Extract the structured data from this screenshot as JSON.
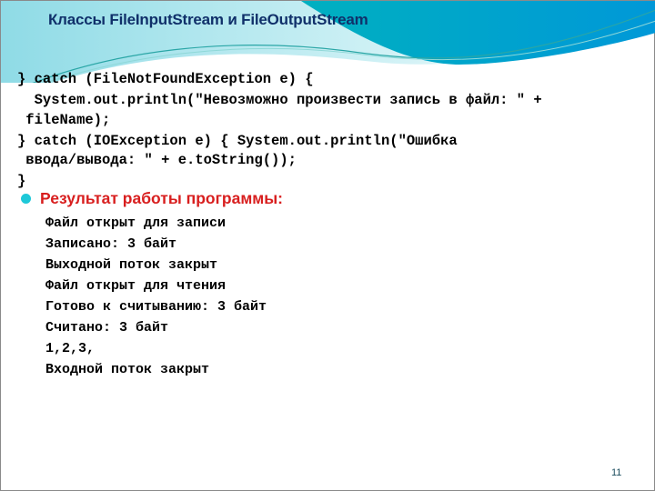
{
  "slide": {
    "title": "Классы FileInputStream и FileOutputStream",
    "code_lines": [
      "} catch (FileNotFoundException e) {",
      "  System.out.println(\"Невозможно произвести запись в файл: \" +",
      " fileName);",
      "} catch (IOException e) { System.out.println(\"Ошибка",
      " ввода/вывода: \" + e.toString());",
      "}"
    ],
    "result_heading": "Результат работы программы:",
    "output_lines": [
      "Файл открыт для записи",
      "Записано: 3 байт",
      "Выходной поток закрыт",
      "Файл открыт для чтения",
      "Готово к считыванию: 3 байт",
      "Считано: 3 байт",
      "1,2,3,",
      "Входной поток закрыт"
    ],
    "page_number": "11",
    "colors": {
      "title": "#10306a",
      "heading": "#d81e1e",
      "bullet": "#1ec8d8",
      "wave_dark": "#0097d0",
      "wave_light": "#6fd3e2"
    }
  }
}
